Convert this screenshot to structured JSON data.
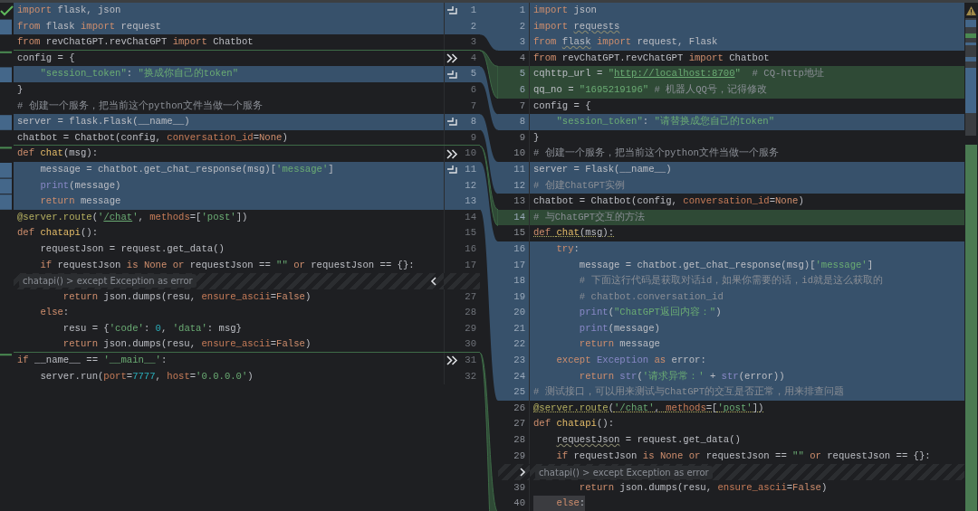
{
  "left": {
    "rows": [
      {
        "kind": "changed",
        "n": "1",
        "action": {
          "kind": "accept"
        },
        "insert_below": false,
        "code": [
          {
            "text": "import",
            "kind": "kw"
          },
          " flask, json"
        ]
      },
      {
        "kind": "changed",
        "n": "2",
        "insert_below": false,
        "code": [
          {
            "text": "from",
            "kind": "kw"
          },
          " flask ",
          {
            "text": "import",
            "kind": "kw"
          },
          " request"
        ]
      },
      {
        "kind": "plain",
        "n": "3",
        "insert_below": true,
        "code": [
          {
            "text": "from",
            "kind": "kw"
          },
          " revChatGPT.revChatGPT ",
          {
            "text": "import",
            "kind": "kw"
          },
          " Chatbot"
        ]
      },
      {
        "kind": "plain",
        "n": "4",
        "action": {
          "kind": "apply"
        },
        "insert_below": false,
        "code": [
          "config = {"
        ]
      },
      {
        "kind": "changed",
        "n": "5",
        "action": {
          "kind": "accept"
        },
        "insert_below": false,
        "code": [
          {
            "text": "    \"session_token\"",
            "kind": "str"
          },
          ": ",
          {
            "text": "\"换成你自己的token\"",
            "kind": "str"
          }
        ]
      },
      {
        "kind": "plain",
        "n": "6",
        "insert_below": false,
        "code": [
          "}"
        ]
      },
      {
        "kind": "plain",
        "n": "7",
        "insert_below": false,
        "code": [
          {
            "text": "# 创建一个服务，把当前这个python文件当做一个服务",
            "kind": "cm"
          }
        ]
      },
      {
        "kind": "changed",
        "n": "8",
        "action": {
          "kind": "accept"
        },
        "insert_below": false,
        "code": [
          "server = flask.Flask(__name__)"
        ]
      },
      {
        "kind": "plain",
        "n": "9",
        "insert_below": true,
        "code": [
          "chatbot = Chatbot(config, ",
          {
            "text": "conversation_id",
            "kind": "par"
          },
          "=",
          {
            "text": "None",
            "kind": "kw"
          },
          ")"
        ]
      },
      {
        "kind": "plain",
        "n": "10",
        "action": {
          "kind": "apply"
        },
        "insert_below": false,
        "code": [
          {
            "text": "def ",
            "kind": "kw"
          },
          {
            "text": "chat",
            "kind": "fn"
          },
          "(msg):"
        ]
      },
      {
        "kind": "changed",
        "n": "11",
        "action": {
          "kind": "accept"
        },
        "insert_below": false,
        "code": [
          "    message = chatbot.get_chat_response(msg)[",
          {
            "text": "'message'",
            "kind": "str"
          },
          "]"
        ]
      },
      {
        "kind": "changed",
        "n": "12",
        "insert_below": false,
        "code": [
          {
            "text": "    print",
            "kind": "bi"
          },
          "(message)"
        ]
      },
      {
        "kind": "changed",
        "n": "13",
        "insert_below": false,
        "code": [
          {
            "text": "    return",
            "kind": "kw"
          },
          " message"
        ]
      },
      {
        "kind": "plain",
        "n": "14",
        "insert_below": false,
        "code": [
          {
            "text": "@server.route",
            "kind": "deco"
          },
          "(",
          {
            "text": "'",
            "kind": "str"
          },
          {
            "text": "/chat",
            "kind": "link"
          },
          {
            "text": "'",
            "kind": "str"
          },
          ", ",
          {
            "text": "methods",
            "kind": "par"
          },
          "=[",
          {
            "text": "'post'",
            "kind": "str"
          },
          "])"
        ]
      },
      {
        "kind": "plain",
        "n": "15",
        "insert_below": false,
        "code": [
          {
            "text": "def ",
            "kind": "kw"
          },
          {
            "text": "chatapi",
            "kind": "fn"
          },
          "():"
        ]
      },
      {
        "kind": "plain",
        "n": "16",
        "insert_below": false,
        "code": [
          "    requestJson = request.get_data()"
        ]
      },
      {
        "kind": "plain",
        "n": "17",
        "insert_below": false,
        "code": [
          {
            "text": "    if",
            "kind": "kw"
          },
          " requestJson ",
          {
            "text": "is None or",
            "kind": "kw"
          },
          " requestJson == ",
          {
            "text": "\"\" ",
            "kind": "str"
          },
          {
            "text": "or",
            "kind": "kw"
          },
          " requestJson == {}:"
        ]
      },
      {
        "kind": "fold",
        "label": "chatapi() > except Exception as error",
        "insert_below": false
      },
      {
        "kind": "plain",
        "n": "27",
        "insert_below": false,
        "code": [
          {
            "text": "        return",
            "kind": "kw"
          },
          " json.dumps(resu, ",
          {
            "text": "ensure_ascii",
            "kind": "par"
          },
          "=",
          {
            "text": "False",
            "kind": "kw"
          },
          ")"
        ]
      },
      {
        "kind": "plain",
        "n": "28",
        "insert_below": false,
        "code": [
          {
            "text": "    else",
            "kind": "kw"
          },
          ":"
        ]
      },
      {
        "kind": "plain",
        "n": "29",
        "insert_below": false,
        "code": [
          "        resu = {",
          {
            "text": "'code'",
            "kind": "str"
          },
          ": ",
          {
            "text": "0",
            "kind": "num"
          },
          ", ",
          {
            "text": "'data'",
            "kind": "str"
          },
          ": msg}"
        ]
      },
      {
        "kind": "plain",
        "n": "30",
        "insert_below": true,
        "code": [
          {
            "text": "        return",
            "kind": "kw"
          },
          " json.dumps(resu, ",
          {
            "text": "ensure_ascii",
            "kind": "par"
          },
          "=",
          {
            "text": "False",
            "kind": "kw"
          },
          ")"
        ]
      },
      {
        "kind": "plain",
        "n": "31",
        "action": {
          "kind": "apply"
        },
        "insert_below": false,
        "code": [
          {
            "text": "if",
            "kind": "kw"
          },
          " __name__ == ",
          {
            "text": "'__main__'",
            "kind": "str"
          },
          ":"
        ]
      },
      {
        "kind": "plain",
        "n": "32",
        "insert_below": false,
        "code": [
          "    server.run(",
          {
            "text": "port",
            "kind": "par"
          },
          "=",
          {
            "text": "7777",
            "kind": "num"
          },
          ", ",
          {
            "text": "host",
            "kind": "par"
          },
          "=",
          {
            "text": "'0.0.0.0'",
            "kind": "str"
          },
          ")"
        ]
      }
    ]
  },
  "right": {
    "rows": [
      {
        "kind": "changed",
        "n": "1",
        "code": [
          {
            "text": "import",
            "kind": "kw"
          },
          " json"
        ]
      },
      {
        "kind": "changed",
        "n": "2",
        "code": [
          {
            "text": "import ",
            "kind": "kw"
          },
          {
            "text": "requests",
            "kind": "u"
          }
        ]
      },
      {
        "kind": "changed",
        "n": "3",
        "code": [
          {
            "text": "from ",
            "kind": "kw"
          },
          {
            "text": "flask",
            "kind": "u"
          },
          {
            "text": " import",
            "kind": "kw"
          },
          " request, Flask"
        ]
      },
      {
        "kind": "plain",
        "n": "4",
        "code": [
          {
            "text": "from",
            "kind": "kw"
          },
          " revChatGPT.revChatGPT ",
          {
            "text": "import",
            "kind": "kw"
          },
          " Chatbot"
        ]
      },
      {
        "kind": "inserted",
        "n": "5",
        "code": [
          "cqhttp_url = ",
          {
            "text": "\"",
            "kind": "str"
          },
          {
            "text": "http://localhost:8700",
            "kind": "link"
          },
          {
            "text": "\"",
            "kind": "str"
          },
          {
            "text": "  # CQ-http地址",
            "kind": "cm"
          }
        ]
      },
      {
        "kind": "inserted",
        "n": "6",
        "code": [
          "qq_no = ",
          {
            "text": "\"1695219196\"",
            "kind": "str"
          },
          {
            "text": " # 机器人QQ号，记得修改",
            "kind": "cm"
          }
        ]
      },
      {
        "kind": "plain",
        "n": "7",
        "code": [
          "config = {"
        ]
      },
      {
        "kind": "changed",
        "n": "8",
        "code": [
          {
            "text": "    \"session_token\"",
            "kind": "str"
          },
          ": ",
          {
            "text": "\"请替换成您自己的token\"",
            "kind": "str"
          }
        ]
      },
      {
        "kind": "plain",
        "n": "9",
        "code": [
          "}"
        ]
      },
      {
        "kind": "plain",
        "n": "10",
        "code": [
          {
            "text": "# 创建一个服务，把当前这个python文件当做一个服务",
            "kind": "cm"
          }
        ]
      },
      {
        "kind": "changed",
        "n": "11",
        "code": [
          "server = Flask(__name__)"
        ]
      },
      {
        "kind": "changed",
        "n": "12",
        "code": [
          {
            "text": "# 创建ChatGPT实例",
            "kind": "cm"
          }
        ]
      },
      {
        "kind": "plain",
        "n": "13",
        "code": [
          "chatbot = Chatbot(config, ",
          {
            "text": "conversation_id",
            "kind": "par"
          },
          "=",
          {
            "text": "None",
            "kind": "kw"
          },
          ")"
        ]
      },
      {
        "kind": "inserted",
        "n": "14",
        "code": [
          {
            "text": "# 与ChatGPT交互的方法",
            "kind": "cm"
          }
        ]
      },
      {
        "kind": "plain",
        "n": "15",
        "code": [
          {
            "text": "def ",
            "kind": "kwdot"
          },
          {
            "text": "chat",
            "kind": "fndot"
          },
          {
            "text": "(msg):",
            "kind": "dot"
          }
        ]
      },
      {
        "kind": "changed",
        "n": "16",
        "code": [
          {
            "text": "    try",
            "kind": "kw"
          },
          ":"
        ]
      },
      {
        "kind": "changed",
        "n": "17",
        "code": [
          "        message = chatbot.get_chat_response(msg)[",
          {
            "text": "'message'",
            "kind": "str"
          },
          "]"
        ]
      },
      {
        "kind": "changed",
        "n": "18",
        "code": [
          {
            "text": "        # 下面这行代码是获取对话id，如果你需要的话，id就是这么获取的",
            "kind": "cm"
          }
        ]
      },
      {
        "kind": "changed",
        "n": "19",
        "code": [
          {
            "text": "        # chatbot.conversation_id",
            "kind": "cm"
          }
        ]
      },
      {
        "kind": "changed",
        "n": "20",
        "code": [
          {
            "text": "        print",
            "kind": "bi"
          },
          "(",
          {
            "text": "\"ChatGPT返回内容：\"",
            "kind": "str"
          },
          ")"
        ]
      },
      {
        "kind": "changed",
        "n": "21",
        "code": [
          {
            "text": "        print",
            "kind": "bi"
          },
          "(message)"
        ]
      },
      {
        "kind": "changed",
        "n": "22",
        "code": [
          {
            "text": "        return",
            "kind": "kw"
          },
          " message"
        ]
      },
      {
        "kind": "changed",
        "n": "23",
        "code": [
          {
            "text": "    except",
            "kind": "kw"
          },
          {
            "text": " Exception",
            "kind": "bi"
          },
          {
            "text": " as",
            "kind": "kw"
          },
          " error:"
        ]
      },
      {
        "kind": "changed",
        "n": "24",
        "code": [
          {
            "text": "        return",
            "kind": "kw"
          },
          {
            "text": " str",
            "kind": "bi"
          },
          "(",
          {
            "text": "'请求异常：'",
            "kind": "str"
          },
          " + ",
          {
            "text": "str",
            "kind": "bi"
          },
          "(error))"
        ]
      },
      {
        "kind": "changed",
        "n": "25",
        "code": [
          {
            "text": "# 测试接口，可以用来测试与ChatGPT的交互是否正常，用来排查问题",
            "kind": "cm"
          }
        ]
      },
      {
        "kind": "plain",
        "n": "26",
        "code": [
          {
            "text": "@server.route",
            "kind": "decodot"
          },
          {
            "text": "(",
            "kind": "dot"
          },
          {
            "text": "'/chat'",
            "kind": "strdot"
          },
          {
            "text": ", ",
            "kind": "dot"
          },
          {
            "text": "methods",
            "kind": "pardot"
          },
          {
            "text": "=[",
            "kind": "dot"
          },
          {
            "text": "'post'",
            "kind": "strdot"
          },
          {
            "text": "])",
            "kind": "dot"
          }
        ]
      },
      {
        "kind": "plain",
        "n": "27",
        "code": [
          {
            "text": "def ",
            "kind": "kw"
          },
          {
            "text": "chatapi",
            "kind": "fn"
          },
          "():"
        ]
      },
      {
        "kind": "plain",
        "n": "28",
        "code": [
          {
            "text": "    requestJson",
            "kind": "u"
          },
          " = request.get_data()"
        ]
      },
      {
        "kind": "plain",
        "n": "29",
        "code": [
          {
            "text": "    if",
            "kind": "kw"
          },
          " requestJson ",
          {
            "text": "is None or",
            "kind": "kw"
          },
          " requestJson == ",
          {
            "text": "\"\" ",
            "kind": "str"
          },
          {
            "text": "or",
            "kind": "kw"
          },
          " requestJson == {}:"
        ]
      },
      {
        "kind": "fold",
        "label": "chatapi() > except Exception as error"
      },
      {
        "kind": "plain",
        "n": "39",
        "code": [
          {
            "text": "        return",
            "kind": "kw"
          },
          " json.dumps(resu, ",
          {
            "text": "ensure_ascii",
            "kind": "par"
          },
          "=",
          {
            "text": "False",
            "kind": "kw"
          },
          ")"
        ]
      },
      {
        "kind": "caret",
        "n": "40",
        "code": [
          {
            "text": "    else",
            "kind": "kw"
          },
          ":"
        ]
      }
    ]
  }
}
